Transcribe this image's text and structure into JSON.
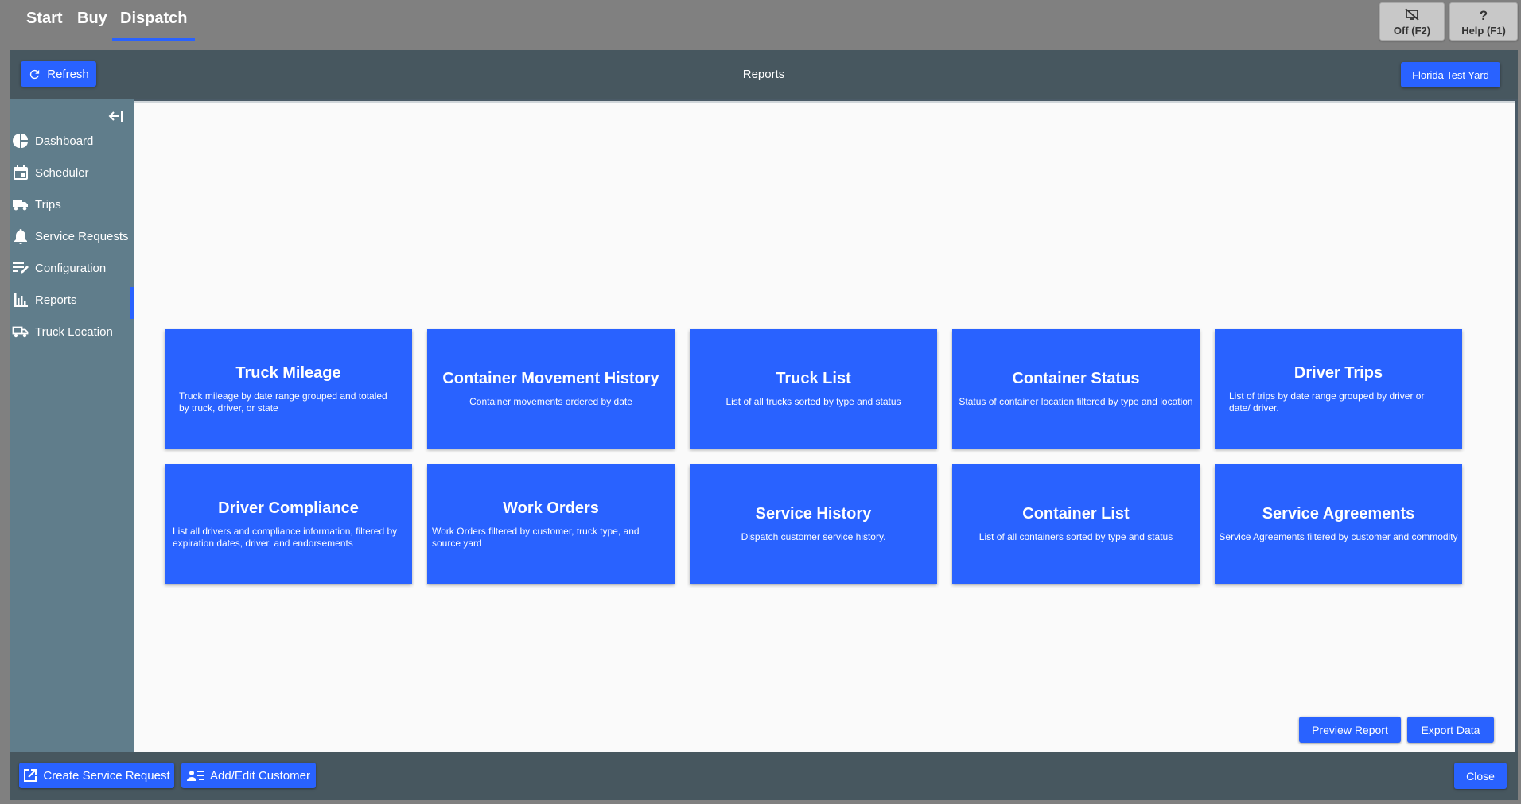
{
  "topnav": {
    "tabs": [
      {
        "label": "Start"
      },
      {
        "label": "Buy"
      },
      {
        "label": "Dispatch"
      }
    ],
    "off_button": {
      "label": "Off (F2)",
      "icon": "screen-off-icon"
    },
    "help_button": {
      "label": "Help (F1)",
      "icon": "question-icon"
    }
  },
  "header": {
    "refresh_label": "Refresh",
    "title": "Reports",
    "yard_label": "Florida Test Yard"
  },
  "sidebar": {
    "items": [
      {
        "label": "Dashboard",
        "icon": "pie-chart-icon"
      },
      {
        "label": "Scheduler",
        "icon": "calendar-icon"
      },
      {
        "label": "Trips",
        "icon": "truck-icon"
      },
      {
        "label": "Service Requests",
        "icon": "bell-icon"
      },
      {
        "label": "Configuration",
        "icon": "edit-list-icon"
      },
      {
        "label": "Reports",
        "icon": "bar-chart-icon",
        "active": true
      },
      {
        "label": "Truck Location",
        "icon": "truck-location-icon"
      }
    ]
  },
  "reports": [
    {
      "title": "Truck Mileage",
      "desc": "Truck mileage by date range grouped and totaled by truck, driver, or state"
    },
    {
      "title": "Container Movement History",
      "desc": "Container movements ordered by date"
    },
    {
      "title": "Truck List",
      "desc": "List of all trucks sorted by type and status"
    },
    {
      "title": "Container Status",
      "desc": "Status of container location filtered by type and location"
    },
    {
      "title": "Driver Trips",
      "desc": "List of trips by date range grouped by driver or date/ driver."
    },
    {
      "title": "Driver Compliance",
      "desc": "List all drivers and compliance information, filtered by expiration dates, driver, and endorsements"
    },
    {
      "title": "Work Orders",
      "desc": "Work Orders filtered by customer, truck type, and source yard"
    },
    {
      "title": "Service History",
      "desc": "Dispatch customer service history."
    },
    {
      "title": "Container List",
      "desc": "List of all containers sorted by type and status"
    },
    {
      "title": "Service Agreements",
      "desc": "Service Agreements filtered by customer and commodity"
    }
  ],
  "actions": {
    "preview_label": "Preview Report",
    "export_label": "Export Data"
  },
  "footer": {
    "create_label": "Create Service Request",
    "customer_label": "Add/Edit Customer",
    "close_label": "Close"
  },
  "colors": {
    "accent": "#2962ff",
    "sidebar": "#607d8b",
    "header": "#47575f",
    "chrome": "#808080"
  }
}
